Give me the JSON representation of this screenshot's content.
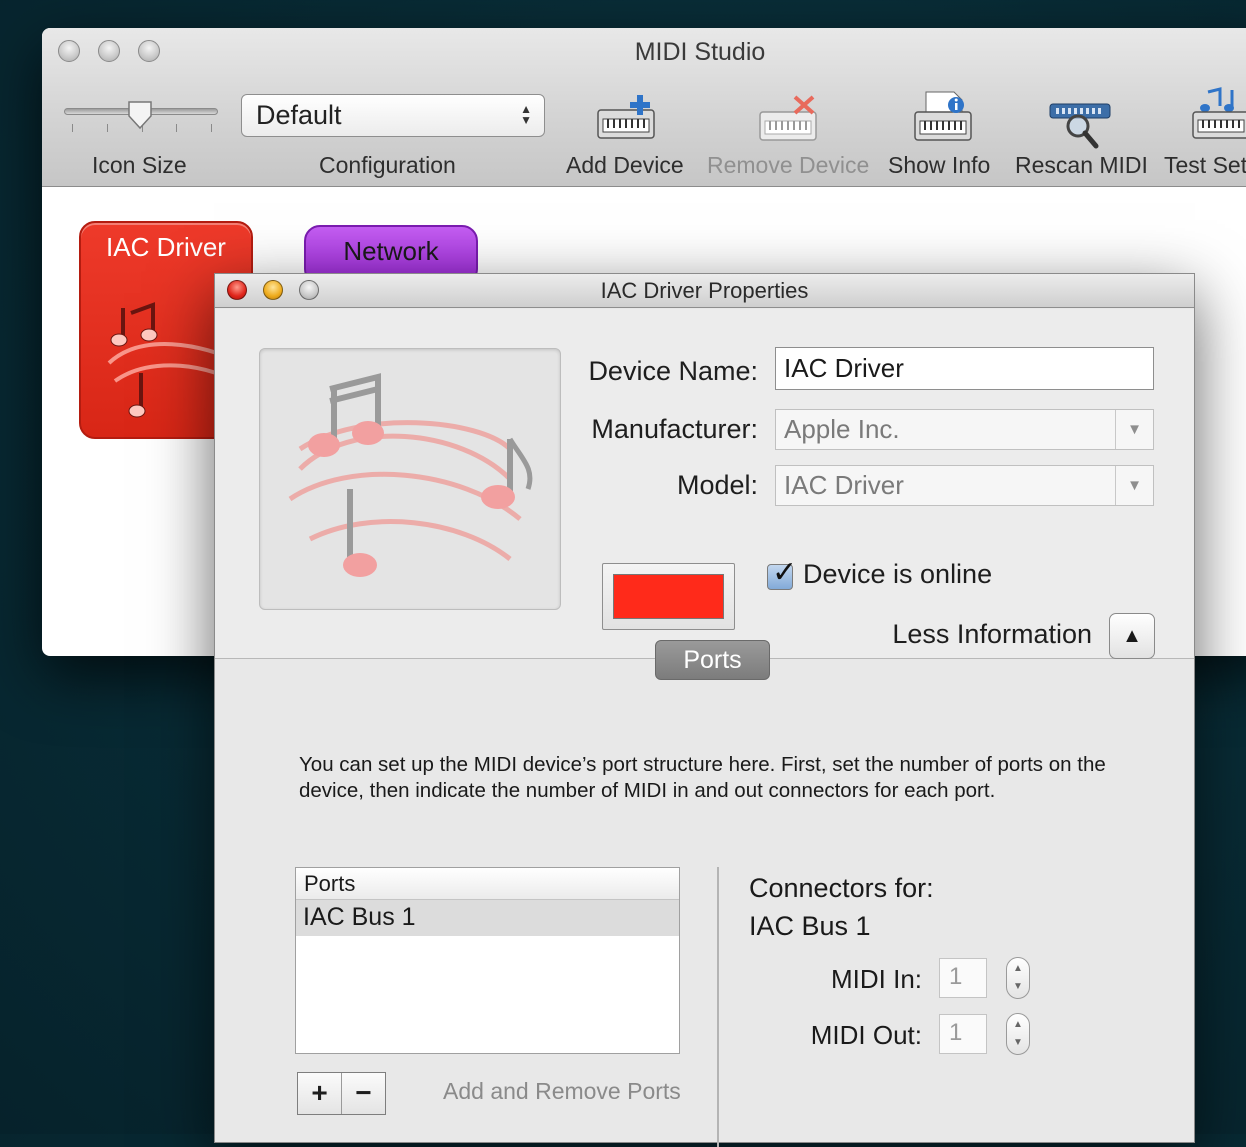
{
  "studio": {
    "title": "MIDI Studio",
    "toolbar": {
      "icon_size_label": "Icon Size",
      "configuration_label": "Configuration",
      "configuration_value": "Default",
      "add_device_label": "Add Device",
      "remove_device_label": "Remove Device",
      "show_info_label": "Show Info",
      "rescan_label": "Rescan MIDI",
      "test_setup_label": "Test Set"
    },
    "devices": [
      {
        "label": "IAC Driver",
        "color": "#e5301f"
      },
      {
        "label": "Network",
        "color": "#b140e6"
      }
    ]
  },
  "props": {
    "title": "IAC Driver Properties",
    "device_name_label": "Device Name:",
    "device_name_value": "IAC Driver",
    "manufacturer_label": "Manufacturer:",
    "manufacturer_value": "Apple Inc.",
    "model_label": "Model:",
    "model_value": "IAC Driver",
    "device_color": "#ff2a1a",
    "online_label": "Device is online",
    "online_checked": true,
    "less_info_label": "Less Information",
    "ports_tab_label": "Ports",
    "description": "You can set up the MIDI device’s port structure here.  First, set the number of ports on the device, then indicate the number of MIDI in and out connectors for each port.",
    "ports_table": {
      "header": "Ports",
      "rows": [
        "IAC Bus 1"
      ]
    },
    "add_button": "+",
    "remove_button": "−",
    "add_remove_label": "Add and Remove Ports",
    "connectors_title": "Connectors for:",
    "connectors_port": "IAC Bus 1",
    "midi_in_label": "MIDI In:",
    "midi_in_value": "1",
    "midi_out_label": "MIDI Out:",
    "midi_out_value": "1"
  }
}
